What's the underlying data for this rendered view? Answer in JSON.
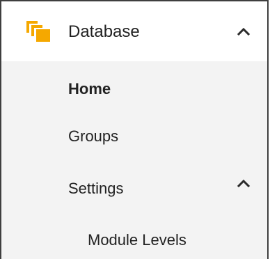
{
  "nav": {
    "group": {
      "label": "Database",
      "icon": "database-folder-icon",
      "expanded_icon": "chevron-up-icon",
      "accent_color": "#f5a800"
    },
    "items": [
      {
        "label": "Home",
        "active": true
      },
      {
        "label": "Groups",
        "active": false
      },
      {
        "label": "Settings",
        "active": false,
        "expanded_icon": "chevron-up-icon",
        "children": [
          {
            "label": "Module Levels"
          }
        ]
      }
    ]
  }
}
